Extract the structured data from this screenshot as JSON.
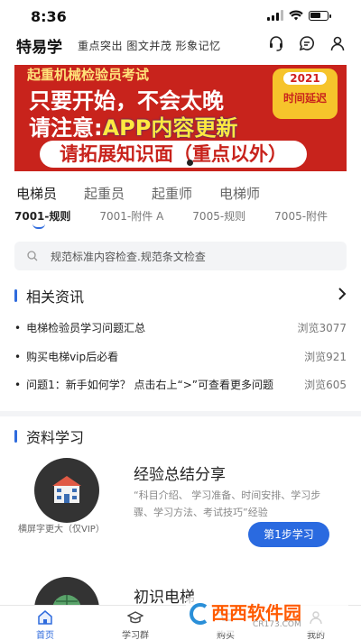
{
  "status": {
    "time": "8:36"
  },
  "header": {
    "app_name": "特易学",
    "slogan": "重点突出 图文并茂 形象记忆"
  },
  "banner": {
    "line1": "起重机械检验员考试",
    "line2": "只要开始，不会太晚",
    "line3_a": "请注意:",
    "line3_b": "APP内容更新",
    "line4": "请拓展知识面（重点以外）",
    "badge_year": "2021",
    "badge_text": "时间延迟"
  },
  "categories": [
    "电梯员",
    "起重员",
    "起重师",
    "电梯师"
  ],
  "subtabs": [
    "7001-规则",
    "7001-附件 A",
    "7005-规则",
    "7005-附件"
  ],
  "search": {
    "placeholder": "规范标准内容检查.规范条文检查"
  },
  "news_section": {
    "title": "相关资讯",
    "items": [
      {
        "title": "电梯检验员学习问题汇总",
        "views": "浏览3077"
      },
      {
        "title": "购买电梯vip后必看",
        "views": "浏览921"
      },
      {
        "title": "问题1：新手如何学？ 点击右上“>”可查看更多问题",
        "views": "浏览605"
      }
    ]
  },
  "study_section": {
    "title": "资料学习",
    "card1": {
      "title": "经验总结分享",
      "desc": "“科目介绍、 学习准备、时间安排、学习步骤、学习方法、考试技巧”经验",
      "vip_note": "横屏字更大（仅VIP）",
      "button": "第1步学习"
    },
    "card2": {
      "title": "初识电梯"
    }
  },
  "tabbar": {
    "home": "首页",
    "group": "学习群",
    "buy": "购买",
    "mine": "我的"
  },
  "watermark": {
    "brand": "西西软件园",
    "url": "CR173.COM"
  },
  "colors": {
    "accent": "#2f6bdd",
    "banner_red": "#c8231c",
    "badge_yellow": "#f6c42b"
  }
}
